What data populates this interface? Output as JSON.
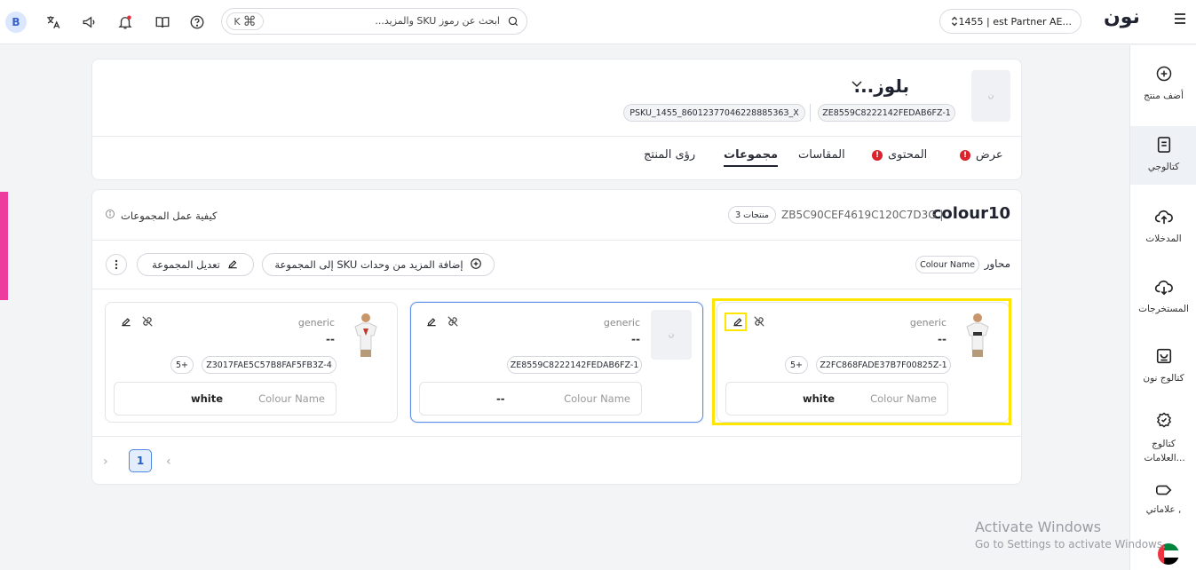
{
  "topbar": {
    "avatar_letter": "B",
    "search_shortcut_letter": "K",
    "search_shortcut_symbol": "⌘",
    "search_placeholder": "ابحث عن رموز SKU والمزيد...",
    "partner_label": "1455 | est Partner AE...",
    "logo_text": "نون"
  },
  "product": {
    "title": "بلوز...",
    "pill_group_code": "ZE8559C8222142FEDAB6FZ-1",
    "pill_psku": "PSKU_1455_8601237704622888536З_X"
  },
  "tabs": [
    {
      "label": "عرض",
      "error": "!"
    },
    {
      "label": "المحتوى",
      "error": "!"
    },
    {
      "label": "المقاسات"
    },
    {
      "label": "مجموعات"
    },
    {
      "label": "رؤى المنتج"
    }
  ],
  "group": {
    "title": "colour10",
    "code": "ZB5C90CEF4619C120C7D3G |",
    "count_badge": "3 منتجات",
    "howto": "كيفية عمل المجموعات",
    "axis_label": "محاور",
    "axis_pill": "Colour Name",
    "add_sku_button": "إضافة المزيد من وحدات SKU إلى المجموعة",
    "edit_group_button": "تعديل المجموعة"
  },
  "variants": [
    {
      "brand": "generic",
      "dash": "--",
      "code": "Z2FC868FADE37B7F00825Z-1",
      "more": "5+",
      "attr_key": "Colour Name",
      "attr_value": "white"
    },
    {
      "brand": "generic",
      "dash": "--",
      "code": "ZE8559C8222142FEDAB6FZ-1",
      "attr_key": "Colour Name",
      "attr_value": "--"
    },
    {
      "brand": "generic",
      "dash": "--",
      "code": "Z3017FAE5C57B8FAF5FB3Z-4",
      "more": "5+",
      "attr_key": "Colour Name",
      "attr_value": "white"
    }
  ],
  "pagination": {
    "current": "1"
  },
  "sidebar": {
    "items": [
      {
        "label": "أضف منتج"
      },
      {
        "label": "كتالوجي"
      },
      {
        "label": "المدخلات"
      },
      {
        "label": "المستخرجات"
      },
      {
        "label": "كتالوج نون"
      },
      {
        "label": "كتالوج العلامات..."
      },
      {
        "label": "علاماتي ,"
      }
    ]
  },
  "watermark": {
    "line1": "Activate Windows",
    "line2": "Go to Settings to activate Windows."
  },
  "thumb_placeholder": "ن",
  "colors": {
    "accent": "#4f86e0",
    "error": "#d9232d",
    "highlight": "#ffe600",
    "pink": "#ee3b9e"
  }
}
